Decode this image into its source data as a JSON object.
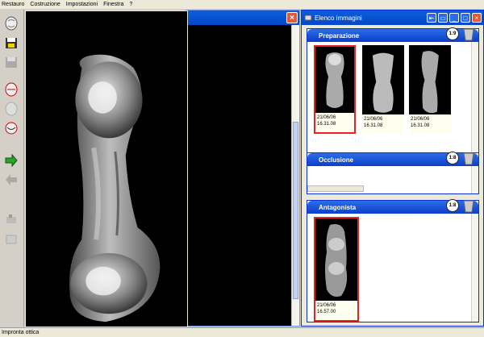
{
  "menu": {
    "items": [
      "Restauro",
      "Costruzione",
      "Impostazioni",
      "Finestra",
      "?"
    ]
  },
  "toolbar": {
    "buttons": [
      "tooth-scan-icon",
      "save-disk-icon",
      "disk-disabled-icon",
      "tooth-red-icon",
      "tooth-disabled-icon",
      "tooth-pair-icon",
      "arrow-right-green-icon",
      "arrow-left-icon",
      "scanner-icon",
      "export-icon"
    ]
  },
  "image_list": {
    "title": "Elenco immagini",
    "panels": [
      {
        "name": "Preparazione",
        "zoom": "1:9",
        "thumbnails": [
          {
            "date": "21/06/06",
            "time": "16.31.08"
          },
          {
            "date": "21/06/06",
            "time": "16.31.08"
          },
          {
            "date": "21/06/06",
            "time": "16.31.08"
          }
        ]
      },
      {
        "name": "Occlusione",
        "zoom": "1:8"
      },
      {
        "name": "Antagonista",
        "zoom": "1:8",
        "thumbnails": [
          {
            "date": "21/06/06",
            "time": "16.57.00"
          }
        ]
      }
    ]
  },
  "status": {
    "text": "Impronta ottica"
  },
  "colors": {
    "xp_blue": "#0a5edb",
    "selection_red": "#e82020",
    "background": "#d4d0c8"
  }
}
